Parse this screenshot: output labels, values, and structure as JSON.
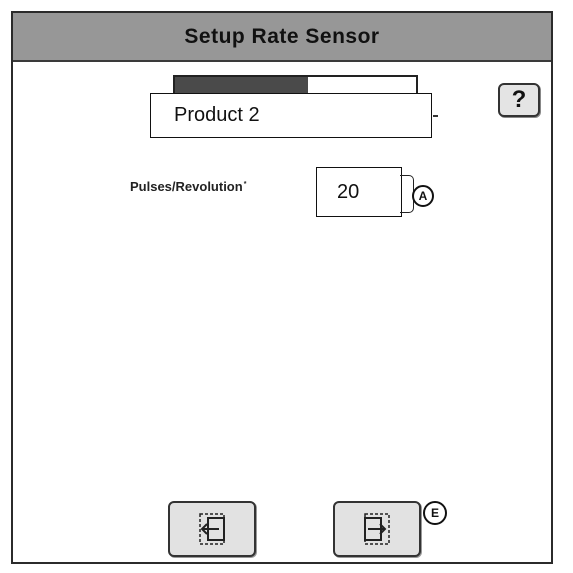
{
  "header": {
    "title": "Setup Rate Sensor"
  },
  "help": {
    "label": "?"
  },
  "product_selector": {
    "value": "Product 2"
  },
  "pulses": {
    "label": "Pulses/Revolution",
    "superscript": "*",
    "value": "20",
    "marker": "A"
  },
  "footer": {
    "back_icon": "exit-left-icon",
    "next_icon": "enter-right-icon",
    "next_marker": "E"
  }
}
